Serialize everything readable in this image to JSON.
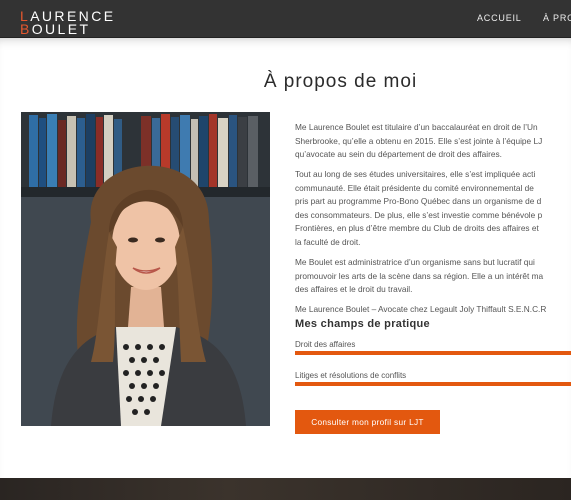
{
  "header": {
    "logo_line1": "Laurence",
    "logo_line2": "Boulet",
    "nav": [
      "ACCUEIL",
      "À PROPOS"
    ]
  },
  "main": {
    "title": "À propos de moi",
    "bio": [
      "Me Laurence Boulet est titulaire d’un baccalauréat en droit de l’Un",
      "Sherbrooke, qu’elle a obtenu en 2015. Elle s’est jointe à l’équipe LJ",
      "qu’avocate au sein du département de droit des affaires.",
      "Tout au long de ses études universitaires, elle s’est impliquée acti",
      "communauté. Elle était présidente du comité environnemental de",
      "pris part au programme Pro-Bono Québec dans un organisme de d",
      "des consommateurs. De plus, elle s’est investie comme bénévole p",
      "Frontières, en plus d’être membre du Club de droits des affaires et",
      "la faculté de droit.",
      "Me Boulet est administratrice d’un organisme sans but lucratif qui",
      "promouvoir les arts de la scène dans sa région. Elle a un intérêt ma",
      "des affaires et le droit du travail.",
      "Me Laurence Boulet – Avocate chez Legault Joly Thiffault S.E.N.C.R"
    ],
    "practice_title": "Mes champs de pratique",
    "skills": [
      {
        "label": "Droit des affaires",
        "level": 1.0
      },
      {
        "label": "Litiges et résolutions de conflits",
        "level": 1.0
      }
    ],
    "cta_label": "Consulter mon profil sur LJT"
  },
  "colors": {
    "accent": "#e3580f",
    "header_bg": "#333333"
  }
}
